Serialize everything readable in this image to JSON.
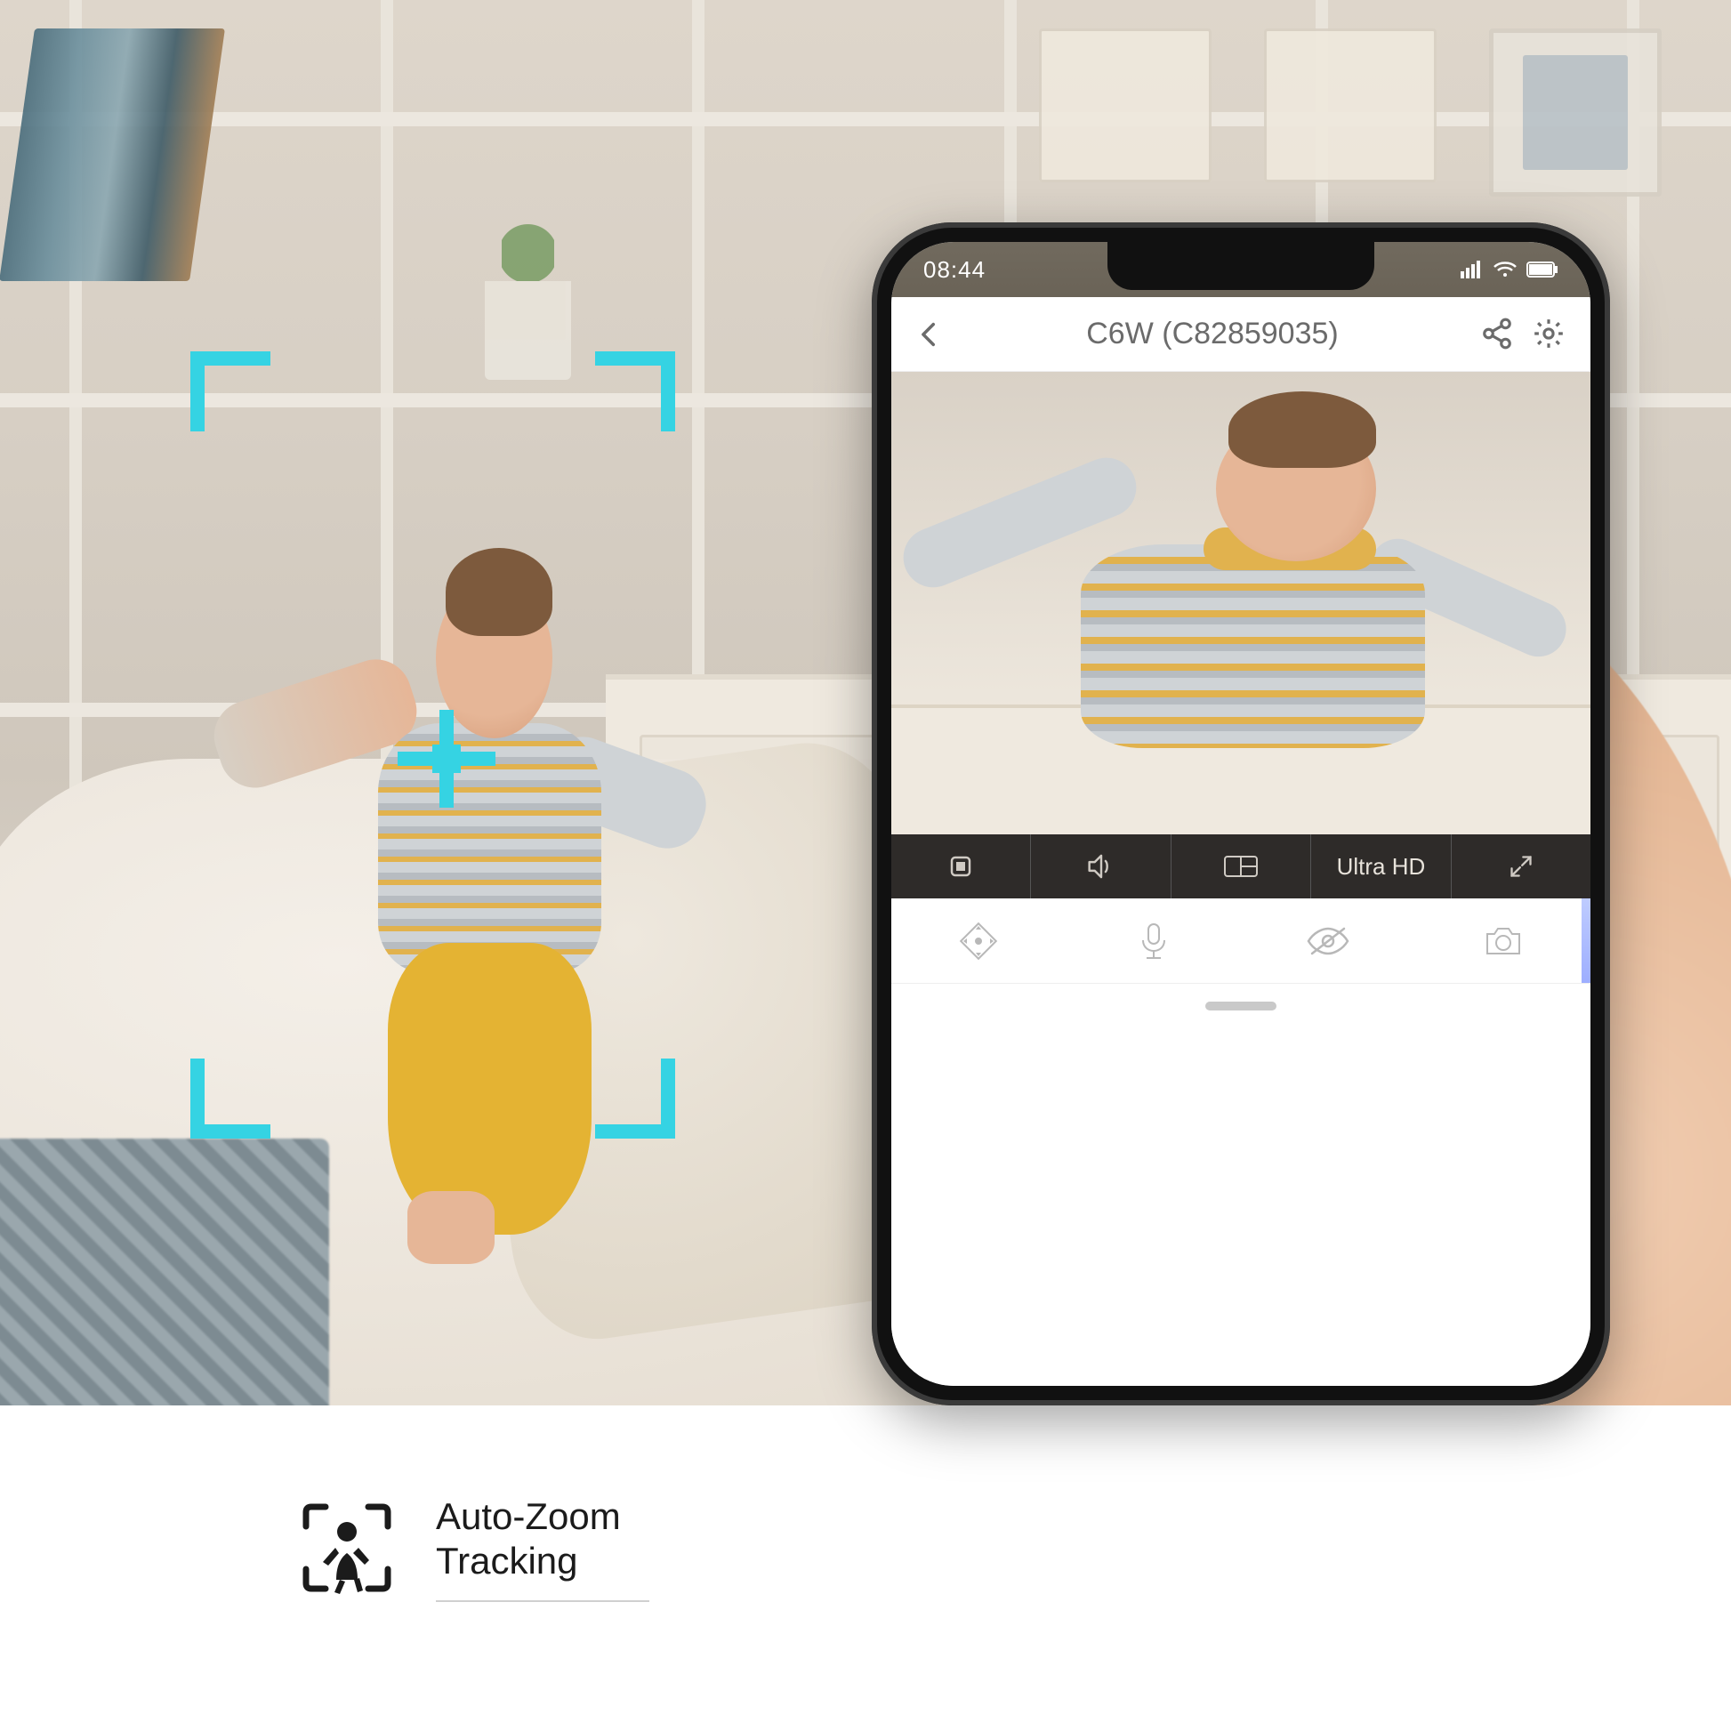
{
  "scene": {
    "reticle_color": "#35d3e3"
  },
  "phone": {
    "status": {
      "time": "08:44"
    },
    "header": {
      "title": "C6W (C82859035)",
      "icons": {
        "back": "chevron-left",
        "share": "share-nodes",
        "settings": "gear"
      }
    },
    "player_bar": {
      "quality_label": "Ultra HD",
      "icons": {
        "stop": "stop-square",
        "sound": "speaker",
        "multiview": "multiview",
        "fullscreen": "expand"
      }
    },
    "tool_row": {
      "icons": {
        "ptz": "ptz-diamond",
        "talk": "microphone",
        "privacy": "eye-off",
        "snapshot": "camera"
      }
    }
  },
  "feature": {
    "line1": "Auto-Zoom",
    "line2": "Tracking"
  }
}
